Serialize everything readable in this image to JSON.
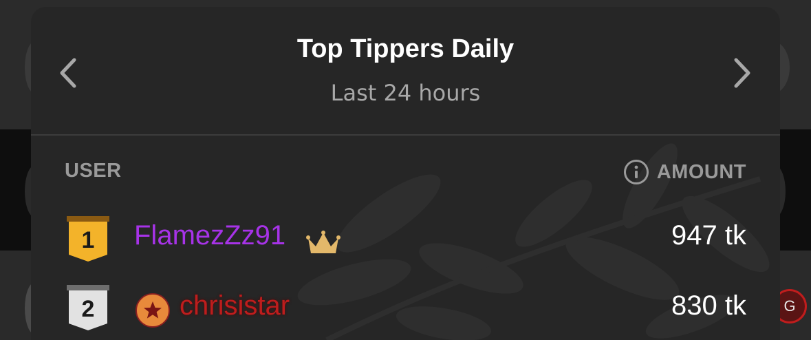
{
  "modal": {
    "title": "Top Tippers Daily",
    "subtitle": "Last 24 hours"
  },
  "table": {
    "columns": {
      "user": "USER",
      "amount": "AMOUNT"
    },
    "rows": [
      {
        "rank": "1",
        "username": "FlamezZz91",
        "amount": "947 tk",
        "name_color": "#a733e8",
        "badge": "crown-icon"
      },
      {
        "rank": "2",
        "username": "chrisistar",
        "amount": "830 tk",
        "name_color": "#bd1d1d",
        "badge": "star-icon"
      }
    ]
  },
  "background": {
    "avatar_letter": "G"
  },
  "icons": {
    "prev": "chevron-left-icon",
    "next": "chevron-right-icon",
    "info": "info-icon"
  },
  "colors": {
    "modal_bg": "#262626",
    "gold": "#f3b32a",
    "silver": "#e2e2e2",
    "crown": "#e3b86a"
  }
}
